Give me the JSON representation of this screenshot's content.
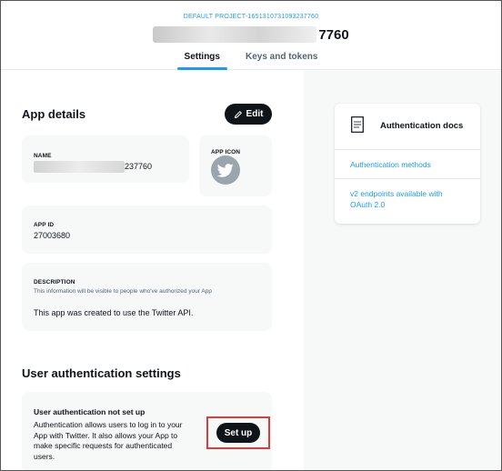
{
  "header": {
    "project_label": "DEFAULT PROJECT-1651310731093237760",
    "app_title_suffix": "7760",
    "tabs": [
      {
        "label": "Settings",
        "active": true
      },
      {
        "label": "Keys and tokens",
        "active": false
      }
    ]
  },
  "app_details": {
    "title": "App details",
    "edit_label": "Edit",
    "name": {
      "label": "NAME",
      "value_suffix": "237760"
    },
    "icon": {
      "label": "APP ICON",
      "icon": "twitter-bird-icon"
    },
    "app_id": {
      "label": "APP ID",
      "value": "27003680"
    },
    "description": {
      "label": "DESCRIPTION",
      "hint": "This information will be visible to people who've authorized your App",
      "value": "This app was created to use the Twitter API."
    }
  },
  "user_auth": {
    "title": "User authentication settings",
    "card_title": "User authentication not set up",
    "card_lines": [
      "Authentication allows users to log in to your",
      "App with Twitter. It also allows your App to",
      "make specific requests for authenticated",
      "users."
    ],
    "setup_label": "Set up"
  },
  "docs": {
    "title": "Authentication docs",
    "icon": "document-icon",
    "links": [
      {
        "lines": [
          "Authentication methods"
        ]
      },
      {
        "lines": [
          "v2 endpoints available with",
          "OAuth 2.0"
        ]
      }
    ]
  },
  "colors": {
    "accent": "#1d9bf0",
    "dark_button": "#0f1419",
    "highlight_outline": "#d6403a",
    "card_bg": "#f7f9f9"
  }
}
